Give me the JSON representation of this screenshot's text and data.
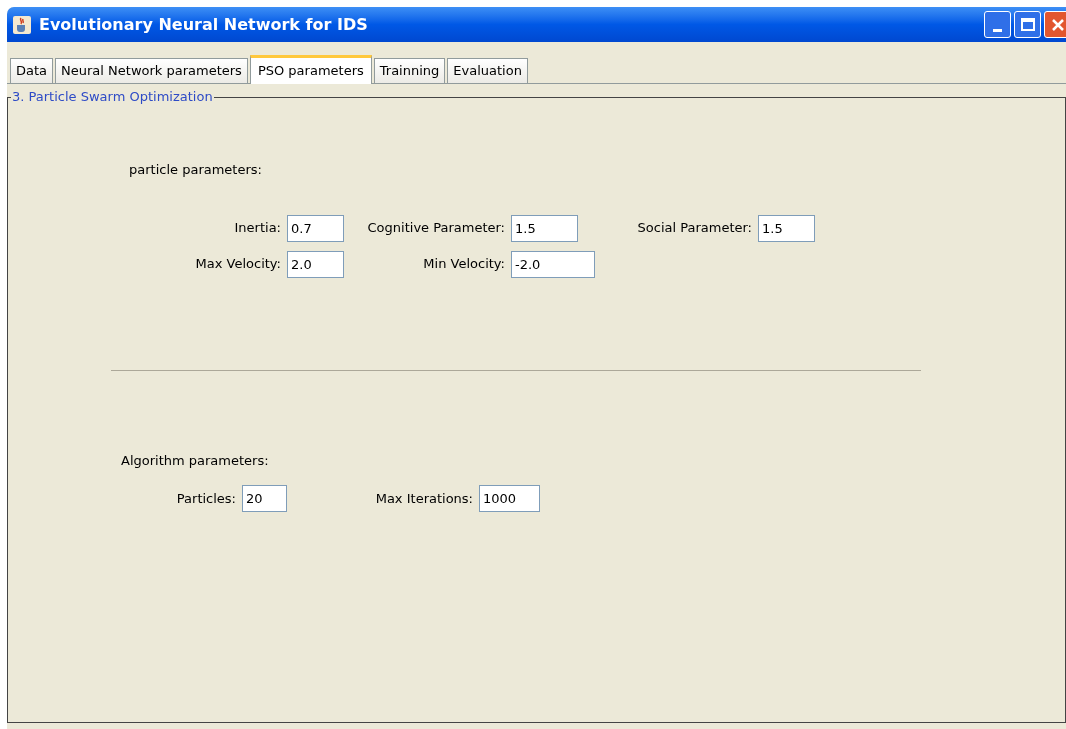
{
  "window": {
    "title": "Evolutionary Neural Network for IDS"
  },
  "tabs": [
    {
      "label": "Data",
      "selected": false
    },
    {
      "label": "Neural Network parameters",
      "selected": false
    },
    {
      "label": "PSO parameters",
      "selected": true
    },
    {
      "label": "Trainning",
      "selected": false
    },
    {
      "label": "Evaluation",
      "selected": false
    }
  ],
  "panel": {
    "title": "3. Particle Swarm Optimization",
    "particle_section": {
      "heading": "particle parameters:",
      "rows": [
        [
          {
            "label": "Inertia:",
            "value": "0.7"
          },
          {
            "label": "Cognitive Parameter:",
            "value": "1.5"
          },
          {
            "label": "Social Parameter:",
            "value": "1.5"
          }
        ],
        [
          {
            "label": "Max Velocity:",
            "value": "2.0"
          },
          {
            "label": "Min Velocity:",
            "value": "-2.0"
          }
        ]
      ]
    },
    "algorithm_section": {
      "heading": "Algorithm parameters:",
      "fields": [
        {
          "label": "Particles:",
          "value": "20"
        },
        {
          "label": "Max Iterations:",
          "value": "1000"
        }
      ]
    }
  }
}
